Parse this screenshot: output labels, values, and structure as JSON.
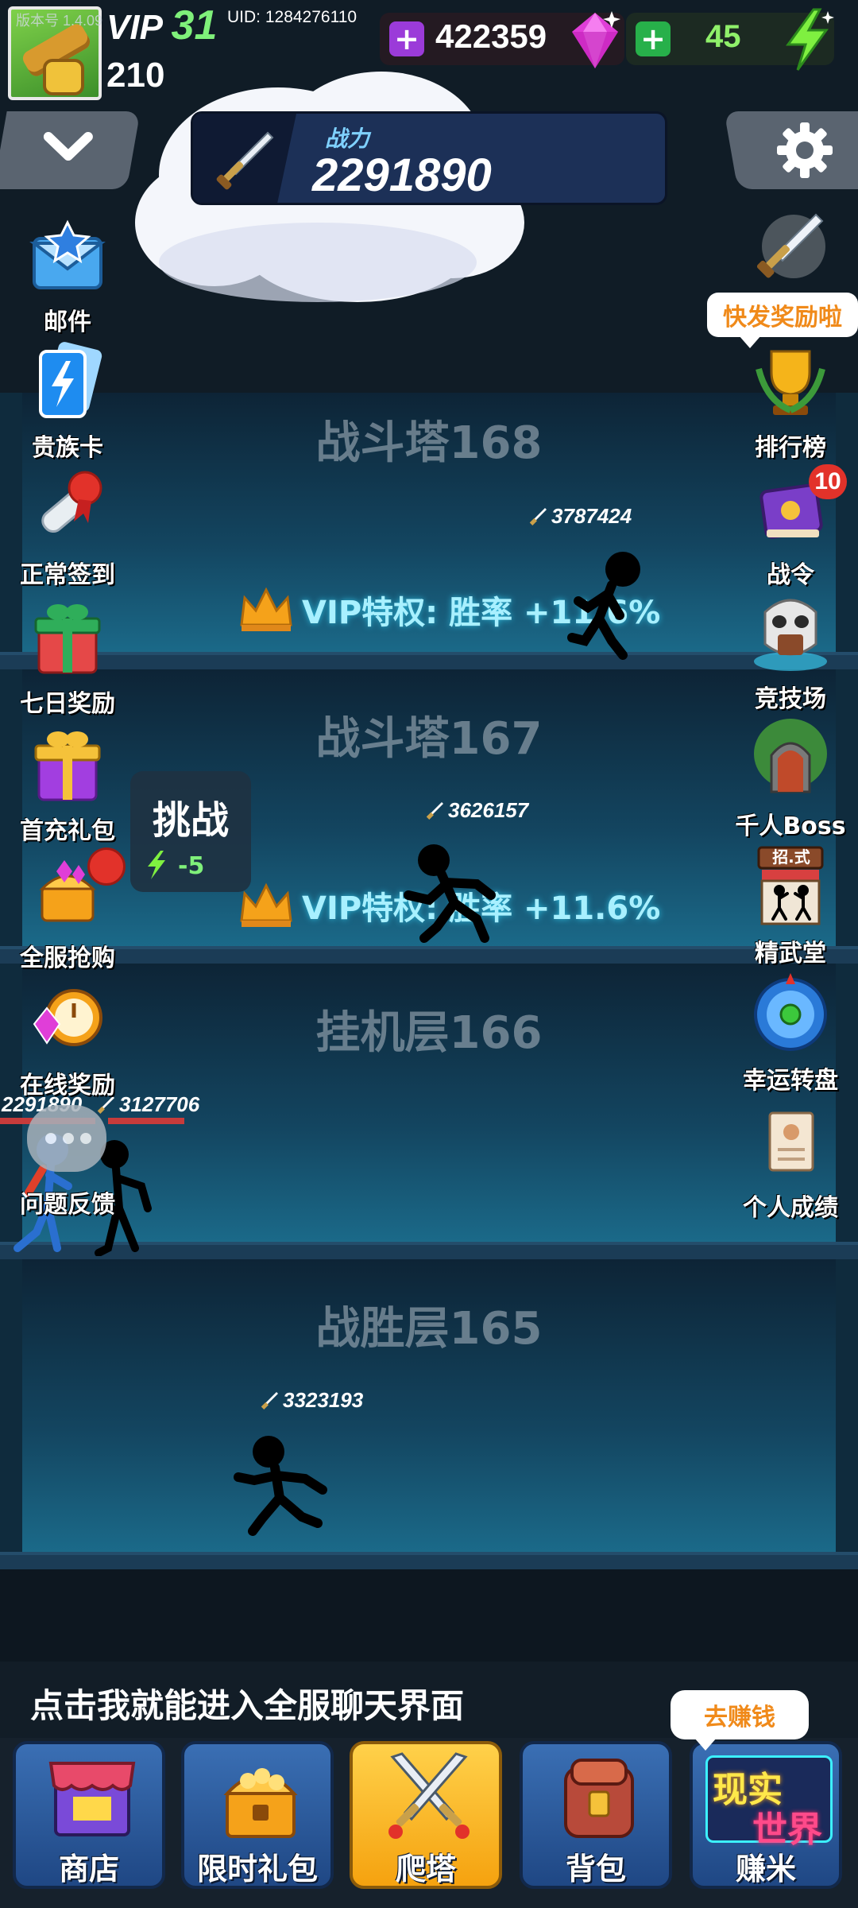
{
  "header": {
    "version": "版本号 1.4.09",
    "vip_prefix": "VIP",
    "vip_level": "31",
    "uid": "UID: 1284276110",
    "player_level": "210",
    "gems": "422359",
    "energy": "45",
    "power_label": "战力",
    "power_value": "2291890"
  },
  "left_menu": [
    {
      "label": "邮件",
      "icon": "mail-icon"
    },
    {
      "label": "贵族卡",
      "icon": "noble-card-icon"
    },
    {
      "label": "正常签到",
      "icon": "sign-in-scroll-icon"
    },
    {
      "label": "七日奖励",
      "icon": "gift-box-icon"
    },
    {
      "label": "首充礼包",
      "icon": "first-recharge-gift-icon"
    },
    {
      "label": "全服抢购",
      "icon": "treasure-chest-icon"
    },
    {
      "label": "在线奖励",
      "icon": "online-reward-clock-icon"
    },
    {
      "label": "问题反馈",
      "icon": "feedback-chat-icon"
    }
  ],
  "right_menu": [
    {
      "label": "快发奖励啦",
      "icon": "glowing-sword-icon"
    },
    {
      "label": "排行榜",
      "icon": "trophy-icon"
    },
    {
      "label": "战令",
      "icon": "battle-pass-book-icon",
      "badge": "10"
    },
    {
      "label": "竞技场",
      "icon": "arena-skull-icon"
    },
    {
      "label": "千人Boss",
      "icon": "boss-gate-icon"
    },
    {
      "label": "精武堂",
      "icon": "dojo-icon",
      "sign": "招.式"
    },
    {
      "label": "幸运转盘",
      "icon": "lucky-wheel-icon"
    },
    {
      "label": "个人成绩",
      "icon": "personal-record-icon"
    }
  ],
  "floors": [
    {
      "title": "战斗塔168",
      "vip": "VIP特权: 胜率 +11.6%",
      "power": "3787424"
    },
    {
      "title": "战斗塔167",
      "vip": "VIP特权: 胜率 +11.6%",
      "power": "3626157"
    },
    {
      "title": "挂机层166",
      "power": "3127706",
      "player_power": "2291890"
    },
    {
      "title": "战胜层165",
      "power": "3323193"
    }
  ],
  "challenge": {
    "label": "挑战",
    "cost": "-5"
  },
  "chat_hint": "点击我就能进入全服聊天界面",
  "earn_bubble": "去赚钱",
  "nav": [
    {
      "label": "商店",
      "icon": "shop-icon"
    },
    {
      "label": "限时礼包",
      "icon": "limited-gift-icon"
    },
    {
      "label": "爬塔",
      "icon": "crossed-swords-icon",
      "active": true
    },
    {
      "label": "背包",
      "icon": "backpack-icon"
    },
    {
      "label": "赚米",
      "icon": "real-world-icon",
      "art_text": [
        "现实",
        "世界"
      ]
    }
  ],
  "colors": {
    "vip_green": "#7ff07a",
    "gem_purple": "#c83be0",
    "energy_green": "#8ff06a",
    "accent_orange": "#f08a1a",
    "nav_blue": "#2b5a9e",
    "nav_active": "#f5a20f"
  }
}
